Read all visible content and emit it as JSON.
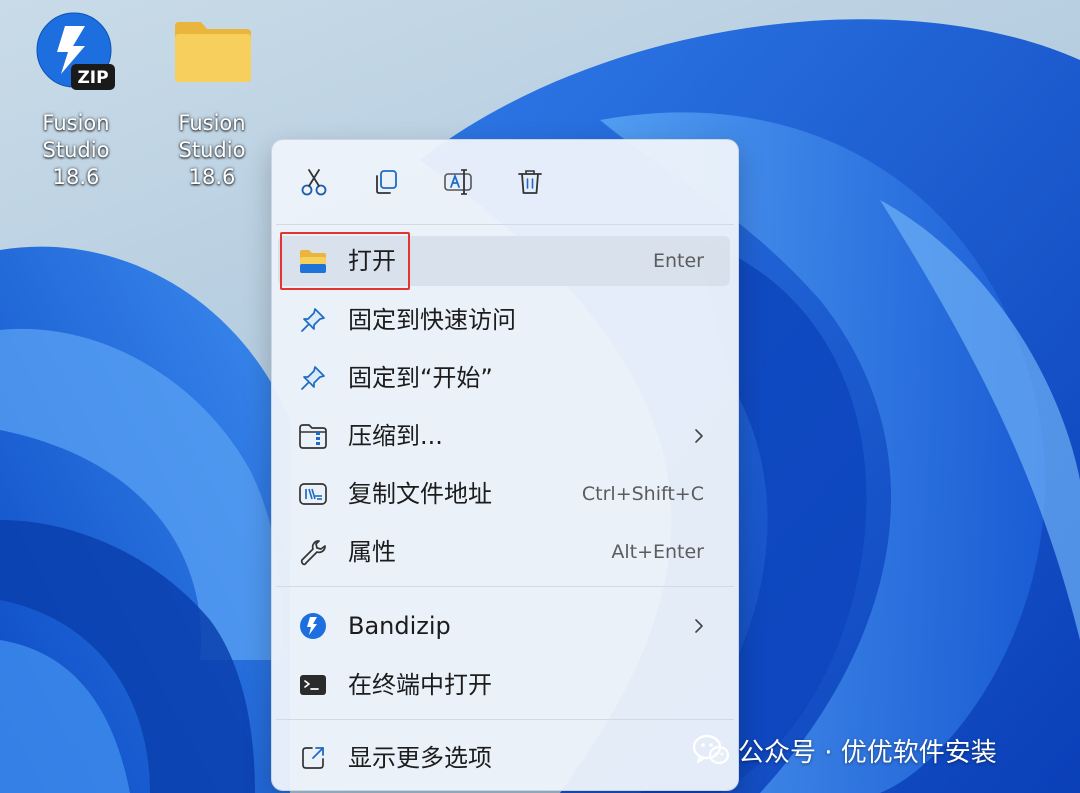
{
  "desktop": {
    "icons": [
      {
        "label": "Fusion Studio 18.6",
        "icon": "bandizip-archive-icon",
        "badge": "ZIP"
      },
      {
        "label": "Fusion Studio 18.6",
        "icon": "folder-icon"
      }
    ]
  },
  "context_menu": {
    "toolbar": [
      {
        "icon": "cut-icon"
      },
      {
        "icon": "copy-icon"
      },
      {
        "icon": "rename-icon"
      },
      {
        "icon": "delete-icon"
      }
    ],
    "items": [
      {
        "label": "打开",
        "shortcut": "Enter",
        "icon": "folder-open-icon",
        "highlighted": true
      },
      {
        "label": "固定到快速访问",
        "shortcut": "",
        "icon": "pin-icon"
      },
      {
        "label": "固定到“开始”",
        "shortcut": "",
        "icon": "pin-icon"
      },
      {
        "label": "压缩到...",
        "shortcut": "",
        "icon": "zip-folder-icon",
        "submenu": true
      },
      {
        "label": "复制文件地址",
        "shortcut": "Ctrl+Shift+C",
        "icon": "copy-path-icon"
      },
      {
        "label": "属性",
        "shortcut": "Alt+Enter",
        "icon": "wrench-icon"
      },
      {
        "label": "Bandizip",
        "shortcut": "",
        "icon": "bandizip-icon",
        "submenu": true
      },
      {
        "label": "在终端中打开",
        "shortcut": "",
        "icon": "terminal-icon"
      },
      {
        "label": "显示更多选项",
        "shortcut": "",
        "icon": "more-options-icon"
      }
    ]
  },
  "watermark": {
    "text": "公众号 · 优优软件安装"
  },
  "colors": {
    "accent": "#0a6cd6",
    "highlight_border": "#e3342f",
    "folder_yellow": "#f4c84a"
  }
}
